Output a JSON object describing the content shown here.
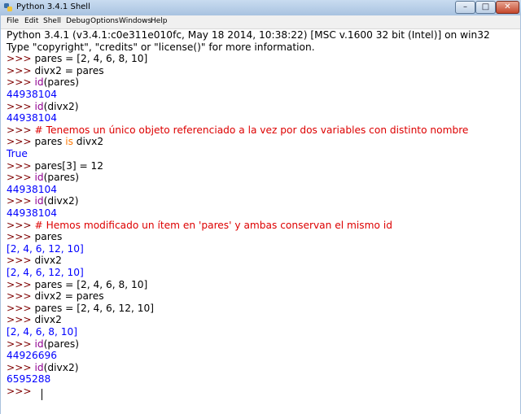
{
  "window": {
    "title": "Python 3.4.1 Shell",
    "buttons": {
      "minimize": "–",
      "maximize": "□",
      "close": "✕"
    }
  },
  "menu": [
    "File",
    "Edit",
    "Shell",
    "Debug",
    "Options",
    "Windows",
    "Help"
  ],
  "header": [
    "Python 3.4.1 (v3.4.1:c0e311e010fc, May 18 2014, 10:38:22) [MSC v.1600 32 bit (Intel)] on win32",
    "Type \"copyright\", \"credits\" or \"license()\" for more information."
  ],
  "prompt": ">>> ",
  "session": [
    {
      "type": "in",
      "parts": [
        [
          "code",
          "pares = [2, 4, 6, 8, 10]"
        ]
      ]
    },
    {
      "type": "in",
      "parts": [
        [
          "code",
          "divx2 = pares"
        ]
      ]
    },
    {
      "type": "in",
      "parts": [
        [
          "bi",
          "id"
        ],
        [
          "code",
          "(pares)"
        ]
      ]
    },
    {
      "type": "out",
      "text": "44938104"
    },
    {
      "type": "in",
      "parts": [
        [
          "bi",
          "id"
        ],
        [
          "code",
          "(divx2)"
        ]
      ]
    },
    {
      "type": "out",
      "text": "44938104"
    },
    {
      "type": "in",
      "parts": [
        [
          "cm",
          "# Tenemos un único objeto referenciado a la vez por dos variables con distinto nombre"
        ]
      ]
    },
    {
      "type": "in",
      "parts": [
        [
          "code",
          "pares "
        ],
        [
          "kw",
          "is"
        ],
        [
          "code",
          " divx2"
        ]
      ]
    },
    {
      "type": "out",
      "text": "True"
    },
    {
      "type": "in",
      "parts": [
        [
          "code",
          "pares[3] = 12"
        ]
      ]
    },
    {
      "type": "in",
      "parts": [
        [
          "bi",
          "id"
        ],
        [
          "code",
          "(pares)"
        ]
      ]
    },
    {
      "type": "out",
      "text": "44938104"
    },
    {
      "type": "in",
      "parts": [
        [
          "bi",
          "id"
        ],
        [
          "code",
          "(divx2)"
        ]
      ]
    },
    {
      "type": "out",
      "text": "44938104"
    },
    {
      "type": "in",
      "parts": [
        [
          "cm",
          "# Hemos modificado un ítem en 'pares' y ambas conservan el mismo id"
        ]
      ]
    },
    {
      "type": "in",
      "parts": [
        [
          "code",
          "pares"
        ]
      ]
    },
    {
      "type": "out",
      "text": "[2, 4, 6, 12, 10]"
    },
    {
      "type": "in",
      "parts": [
        [
          "code",
          "divx2"
        ]
      ]
    },
    {
      "type": "out",
      "text": "[2, 4, 6, 12, 10]"
    },
    {
      "type": "in",
      "parts": [
        [
          "code",
          "pares = [2, 4, 6, 8, 10]"
        ]
      ]
    },
    {
      "type": "in",
      "parts": [
        [
          "code",
          "divx2 = pares"
        ]
      ]
    },
    {
      "type": "in",
      "parts": [
        [
          "code",
          "pares = [2, 4, 6, 12, 10]"
        ]
      ]
    },
    {
      "type": "in",
      "parts": [
        [
          "code",
          "divx2"
        ]
      ]
    },
    {
      "type": "out",
      "text": "[2, 4, 6, 8, 10]"
    },
    {
      "type": "in",
      "parts": [
        [
          "bi",
          "id"
        ],
        [
          "code",
          "(pares)"
        ]
      ]
    },
    {
      "type": "out",
      "text": "44926696"
    },
    {
      "type": "in",
      "parts": [
        [
          "bi",
          "id"
        ],
        [
          "code",
          "(divx2)"
        ]
      ]
    },
    {
      "type": "out",
      "text": "6595288"
    },
    {
      "type": "in",
      "parts": []
    }
  ],
  "colors": {
    "output": "#0000ff",
    "prompt": "#7f0000",
    "comment": "#dd0000",
    "keyword": "#ff7700",
    "builtin": "#900090"
  }
}
